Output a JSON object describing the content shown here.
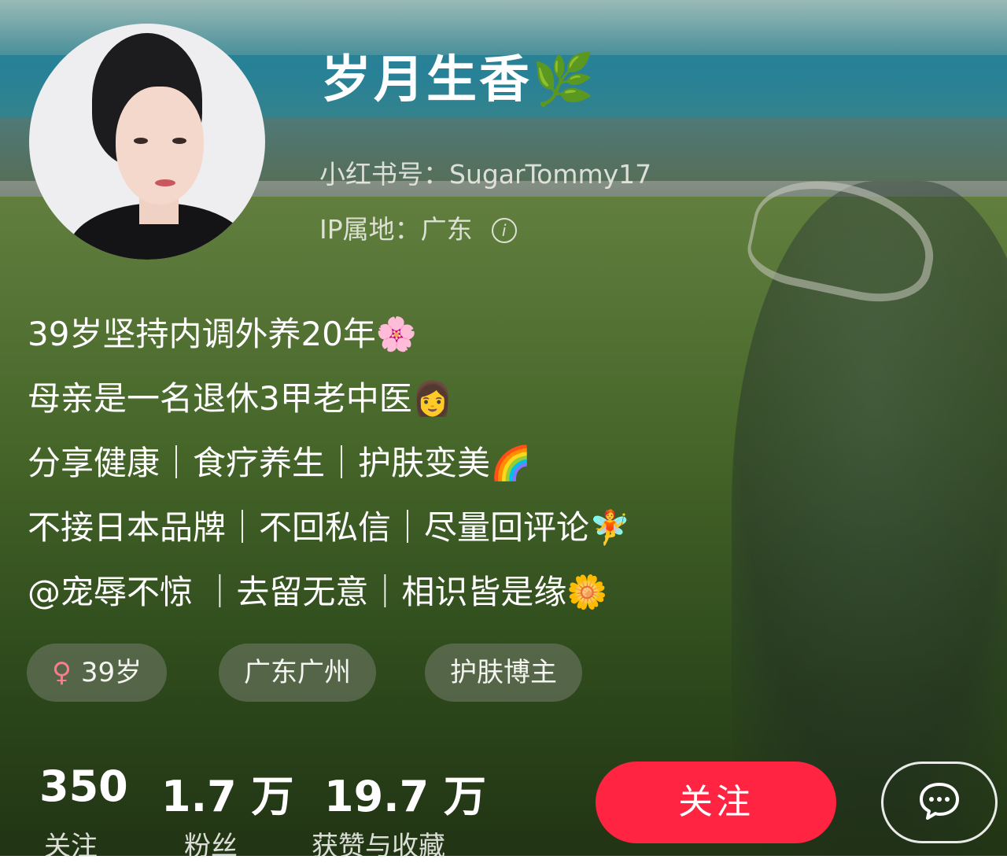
{
  "profile": {
    "name": "岁月生香🌿",
    "id_label": "小红书号：",
    "id_value": "SugarTommy17",
    "ip_label": "IP属地：",
    "ip_value": "广东"
  },
  "bio": [
    "39岁坚持内调外养20年🌸",
    "母亲是一名退休3甲老中医👩",
    "分享健康｜食疗养生｜护肤变美🌈",
    "不接日本品牌｜不回私信｜尽量回评论🧚",
    "@宠辱不惊 ｜去留无意｜相识皆是缘🌼"
  ],
  "tags": {
    "gender_symbol": "♀",
    "age": "39岁",
    "location": "广东广州",
    "category": "护肤博主"
  },
  "stats": [
    {
      "value": "350",
      "label": "关注"
    },
    {
      "value": "1.7 万",
      "label": "粉丝"
    },
    {
      "value": "19.7 万",
      "label": "获赞与收藏"
    }
  ],
  "actions": {
    "follow_label": "关注",
    "chat_icon": "chat-bubble-icon"
  },
  "colors": {
    "follow_button": "#ff2442",
    "female_symbol": "#ff7a8a"
  }
}
